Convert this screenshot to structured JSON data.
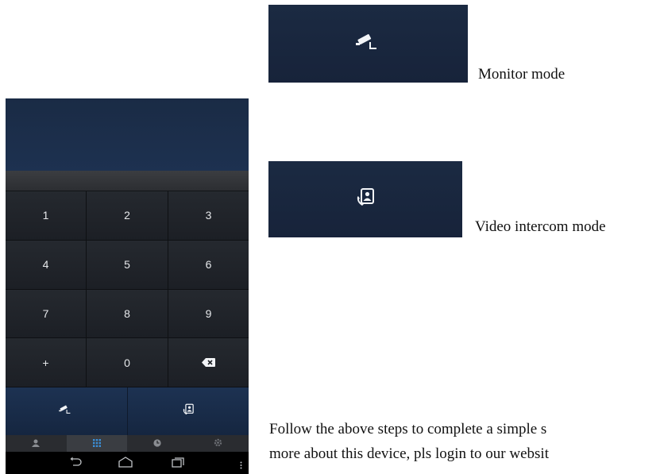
{
  "captions": {
    "monitor_mode": "Monitor mode",
    "video_intercom_mode": "Video intercom mode"
  },
  "footer_text": {
    "line1": "Follow the above steps to complete a simple s",
    "line2": "more about this device, pls login to our websit"
  },
  "keypad": {
    "keys": [
      "1",
      "2",
      "3",
      "4",
      "5",
      "6",
      "7",
      "8",
      "9",
      "+",
      "0"
    ],
    "delete_icon": "backspace-icon"
  },
  "call_buttons": [
    {
      "icon": "cctv-camera-icon"
    },
    {
      "icon": "video-intercom-icon"
    }
  ],
  "tabs": [
    {
      "icon": "contacts-icon",
      "active": false
    },
    {
      "icon": "dialpad-icon",
      "active": true
    },
    {
      "icon": "history-icon",
      "active": false
    },
    {
      "icon": "settings-icon",
      "active": false
    }
  ],
  "colors": {
    "panel_blue": "#1b2a42",
    "keypad_dark": "#1e2228",
    "active_tab_icon": "#3a8fd8"
  }
}
